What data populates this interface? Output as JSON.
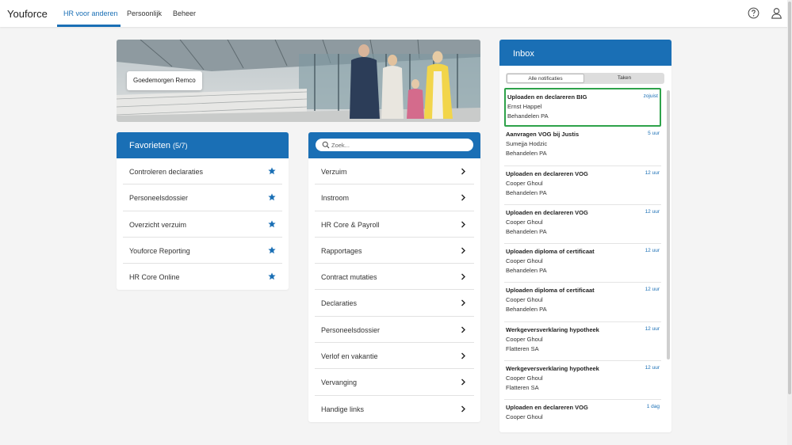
{
  "app": {
    "brand": "Youforce"
  },
  "nav": {
    "tabs": [
      {
        "label": "HR voor anderen",
        "active": true
      },
      {
        "label": "Persoonlijk"
      },
      {
        "label": "Beheer"
      }
    ]
  },
  "header_icons": [
    "help-icon",
    "user-icon"
  ],
  "hero": {
    "greeting": "Goedemorgen Remco"
  },
  "favorites": {
    "title": "Favorieten",
    "count": "(5/7)",
    "items": [
      {
        "label": "Controleren declaraties"
      },
      {
        "label": "Personeelsdossier"
      },
      {
        "label": "Overzicht verzuim"
      },
      {
        "label": "Youforce Reporting"
      },
      {
        "label": "HR Core Online"
      }
    ]
  },
  "menu": {
    "search_placeholder": "Zoek...",
    "items": [
      {
        "label": "Verzuim"
      },
      {
        "label": "Instroom"
      },
      {
        "label": "HR Core & Payroll"
      },
      {
        "label": "Rapportages"
      },
      {
        "label": "Contract mutaties"
      },
      {
        "label": "Declaraties"
      },
      {
        "label": "Personeelsdossier"
      },
      {
        "label": "Verlof en vakantie"
      },
      {
        "label": "Vervanging"
      },
      {
        "label": "Handige links"
      }
    ]
  },
  "inbox": {
    "title": "Inbox",
    "tabs": {
      "all": "Alle notificaties",
      "tasks": "Taken"
    },
    "items": [
      {
        "title": "Uploaden en declareren BIG",
        "time": "zojuist",
        "person": "Ernst Happel",
        "task": "Behandelen PA",
        "selected": true
      },
      {
        "title": "Aanvragen VOG bij Justis",
        "time": "5 uur",
        "person": "Sumejja Hodzic",
        "task": "Behandelen PA"
      },
      {
        "title": "Uploaden en declareren VOG",
        "time": "12 uur",
        "person": "Cooper Ghoul",
        "task": "Behandelen PA"
      },
      {
        "title": "Uploaden en declareren VOG",
        "time": "12 uur",
        "person": "Cooper Ghoul",
        "task": "Behandelen PA"
      },
      {
        "title": "Uploaden diploma of certificaat",
        "time": "12 uur",
        "person": "Cooper Ghoul",
        "task": "Behandelen PA"
      },
      {
        "title": "Uploaden diploma of certificaat",
        "time": "12 uur",
        "person": "Cooper Ghoul",
        "task": "Behandelen PA"
      },
      {
        "title": "Werkgeversverklaring hypotheek",
        "time": "12 uur",
        "person": "Cooper Ghoul",
        "task": "Flatteren SA"
      },
      {
        "title": "Werkgeversverklaring hypotheek",
        "time": "12 uur",
        "person": "Cooper Ghoul",
        "task": "Flatteren SA"
      },
      {
        "title": "Uploaden en declareren VOG",
        "time": "1 dag",
        "person": "Cooper Ghoul",
        "task": ""
      }
    ]
  },
  "colors": {
    "accent": "#1a6fb5",
    "selected_border": "#2ea24a",
    "background": "#f4f4f4"
  }
}
